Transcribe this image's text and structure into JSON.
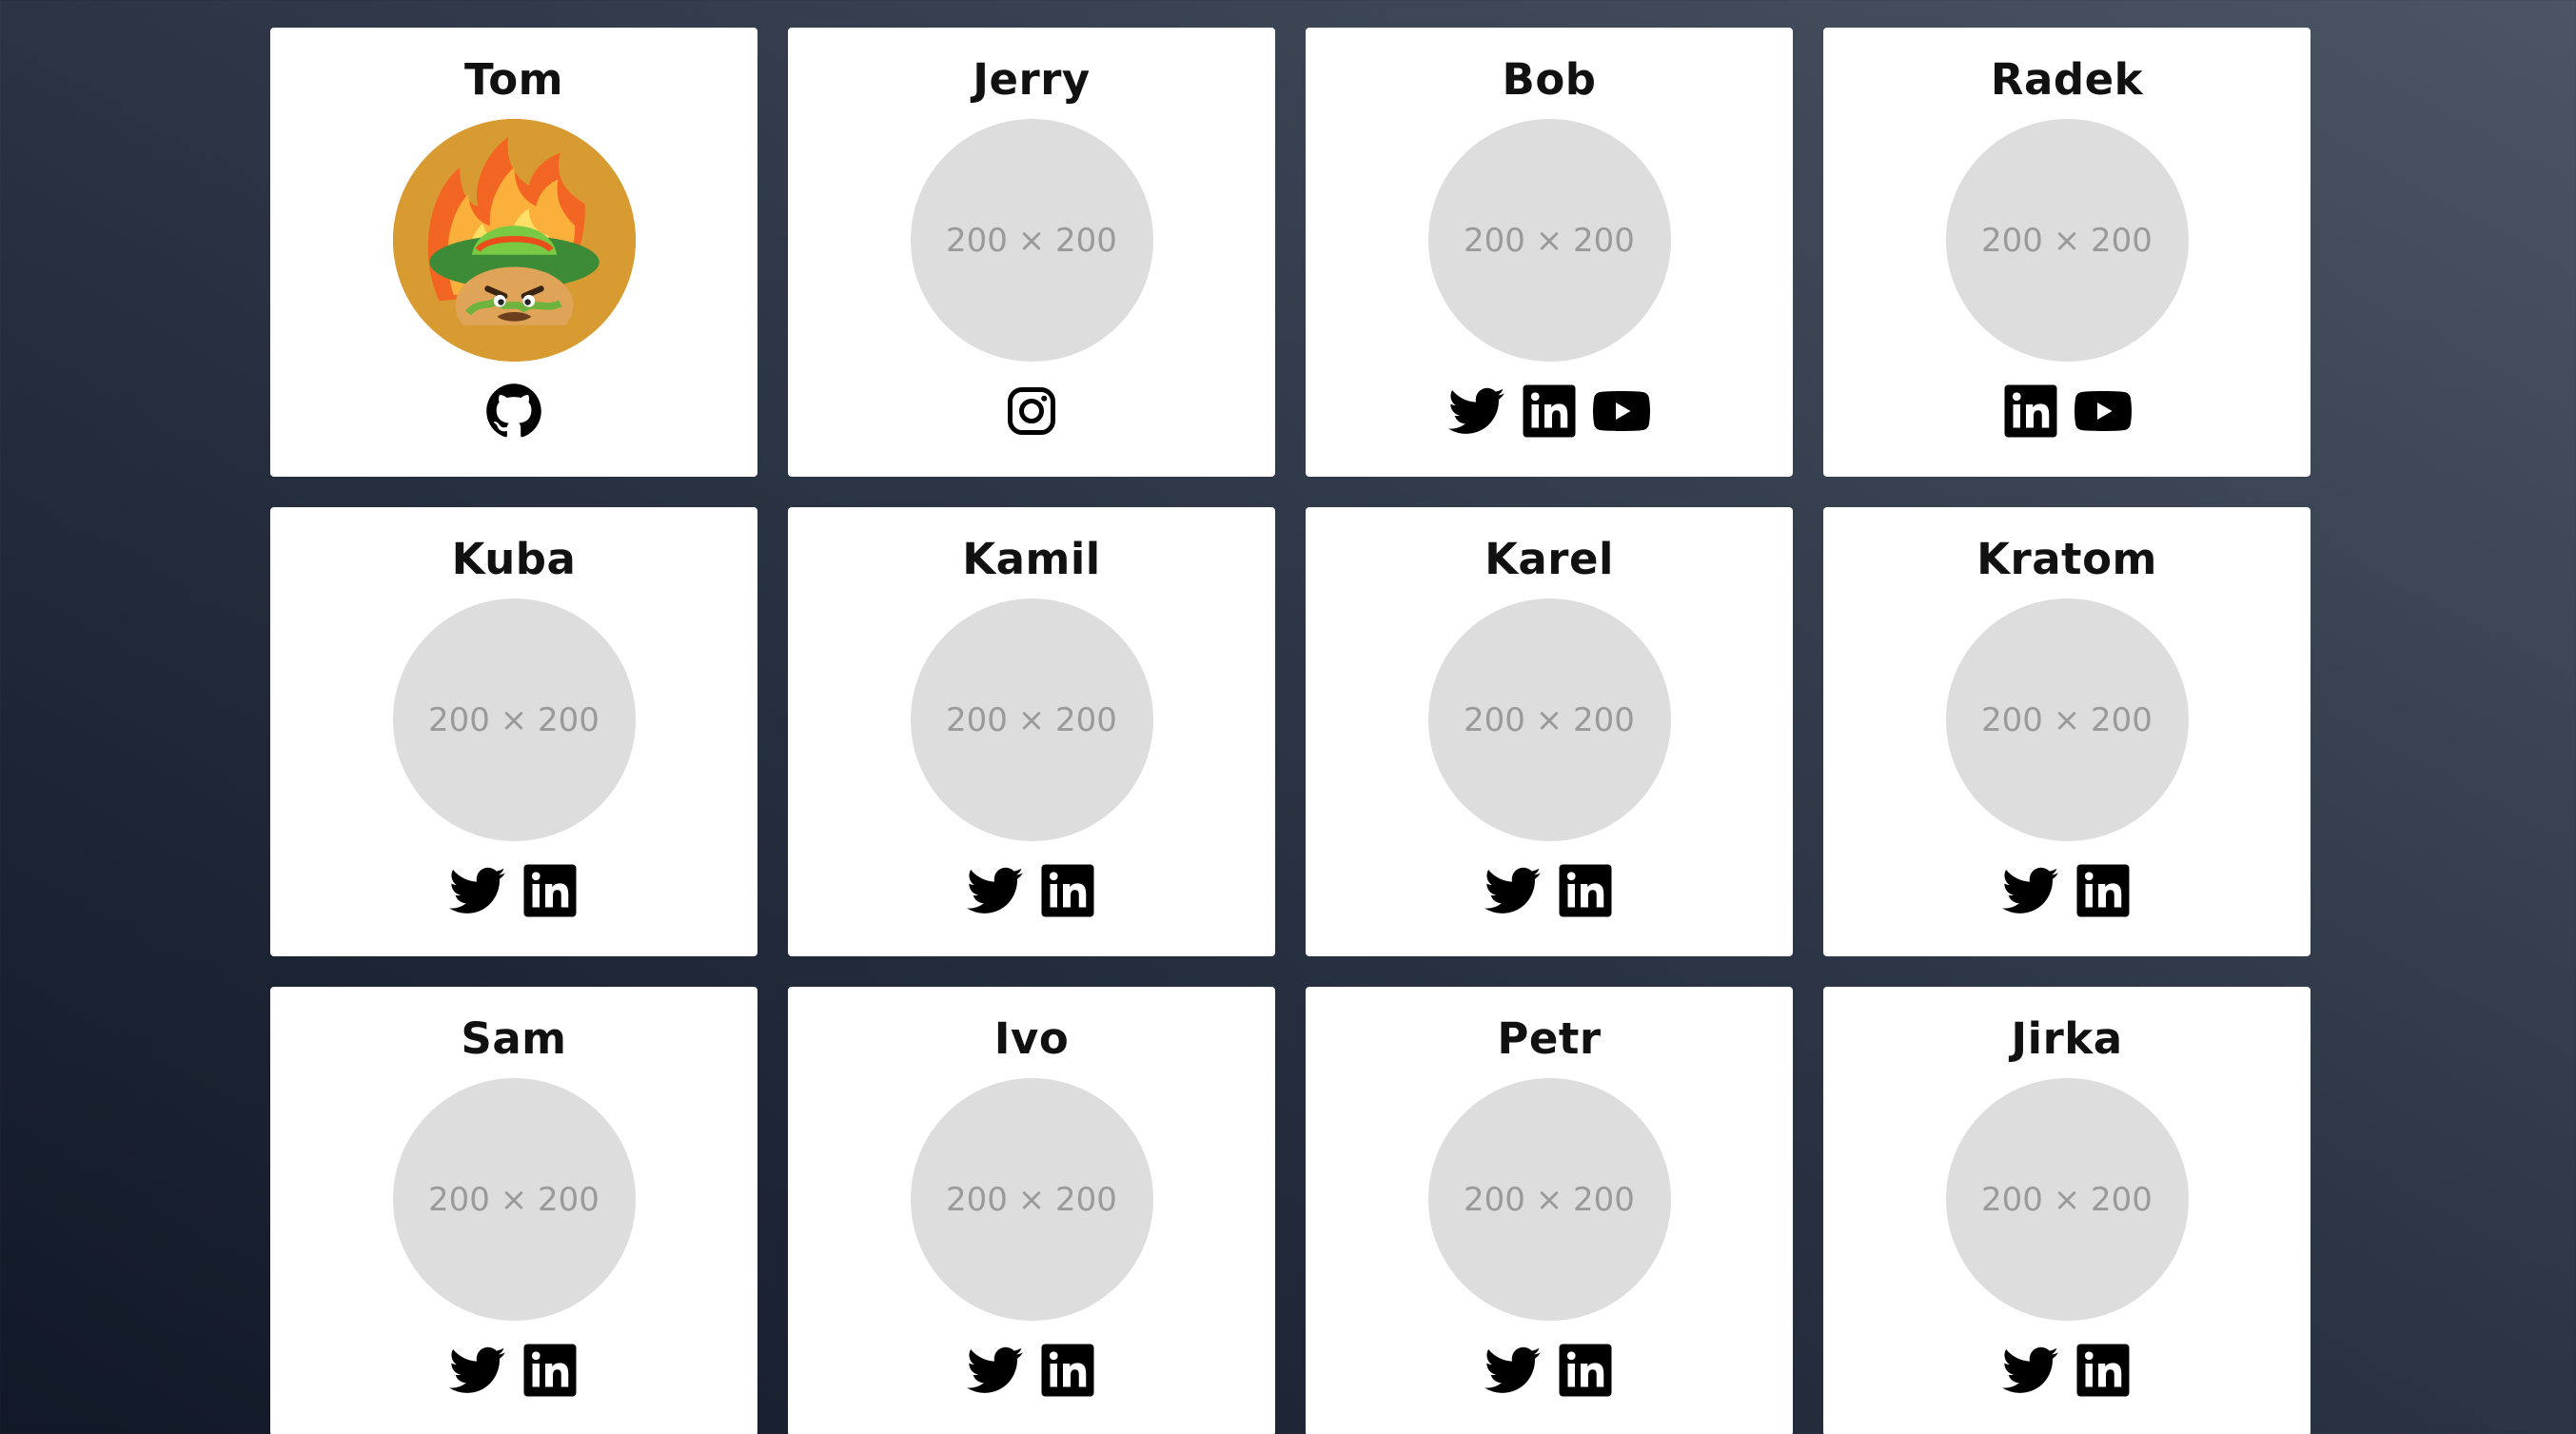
{
  "accent_text_color": "#111111",
  "avatar_placeholder_color": "#dddddd",
  "members": [
    {
      "name": "Tom",
      "avatar": "custom-taco-sombrero-image",
      "socials": [
        "github-icon"
      ]
    },
    {
      "name": "Jerry",
      "avatar": "200 × 200",
      "socials": [
        "instagram-icon"
      ]
    },
    {
      "name": "Bob",
      "avatar": "200 × 200",
      "socials": [
        "twitter-icon",
        "linkedin-icon",
        "youtube-icon"
      ]
    },
    {
      "name": "Radek",
      "avatar": "200 × 200",
      "socials": [
        "linkedin-icon",
        "youtube-icon"
      ]
    },
    {
      "name": "Kuba",
      "avatar": "200 × 200",
      "socials": [
        "twitter-icon",
        "linkedin-icon"
      ]
    },
    {
      "name": "Kamil",
      "avatar": "200 × 200",
      "socials": [
        "twitter-icon",
        "linkedin-icon"
      ]
    },
    {
      "name": "Karel",
      "avatar": "200 × 200",
      "socials": [
        "twitter-icon",
        "linkedin-icon"
      ]
    },
    {
      "name": "Kratom",
      "avatar": "200 × 200",
      "socials": [
        "twitter-icon",
        "linkedin-icon"
      ]
    },
    {
      "name": "Sam",
      "avatar": "200 × 200",
      "socials": [
        "twitter-icon",
        "linkedin-icon"
      ]
    },
    {
      "name": "Ivo",
      "avatar": "200 × 200",
      "socials": [
        "twitter-icon",
        "linkedin-icon"
      ]
    },
    {
      "name": "Petr",
      "avatar": "200 × 200",
      "socials": [
        "twitter-icon",
        "linkedin-icon"
      ]
    },
    {
      "name": "Jirka",
      "avatar": "200 × 200",
      "socials": [
        "twitter-icon",
        "linkedin-icon"
      ]
    }
  ]
}
